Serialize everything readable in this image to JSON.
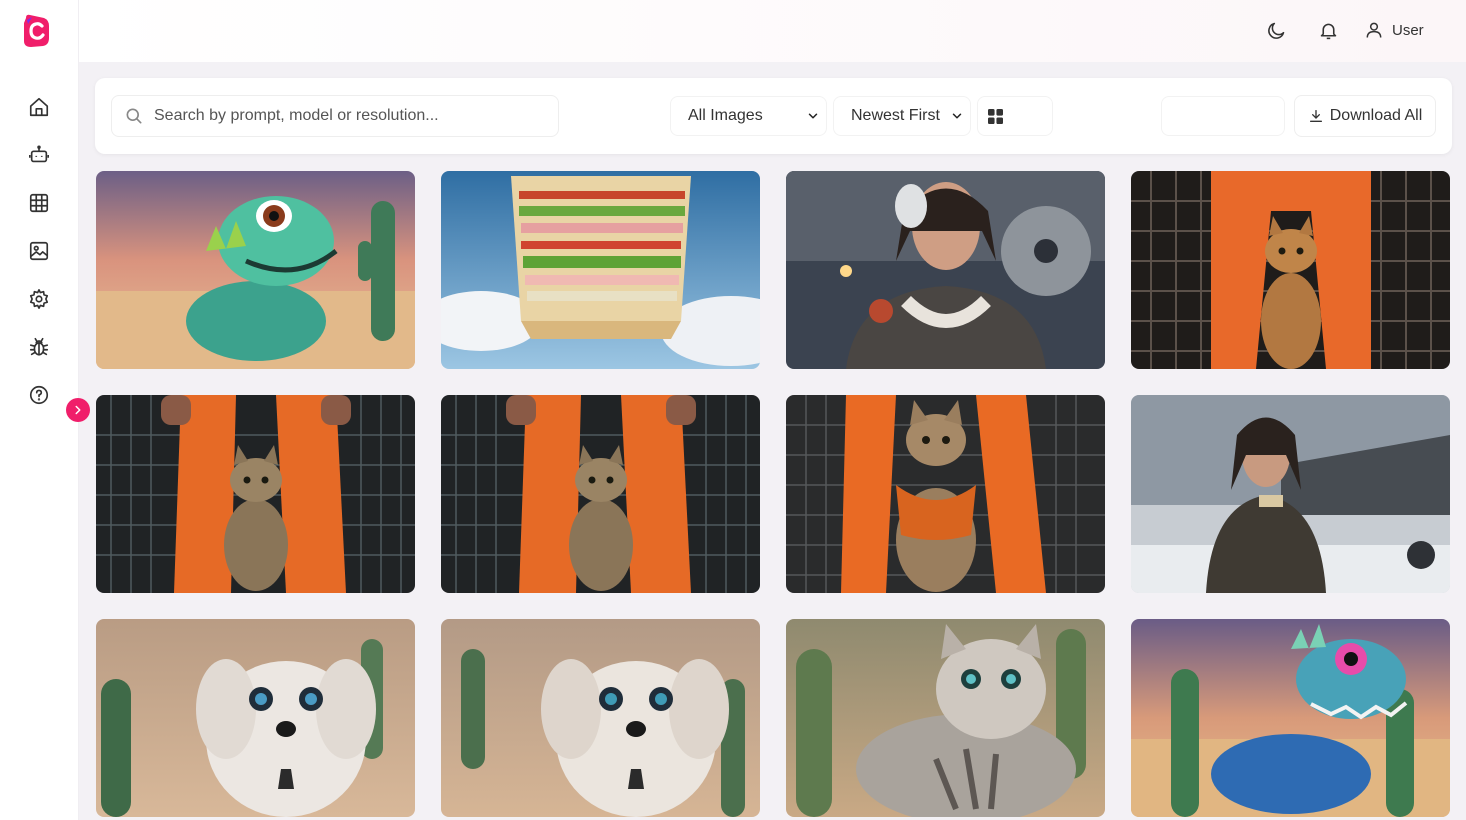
{
  "app": {
    "brand_color": "#f01e6a",
    "logo_icon": "c-logo-icon"
  },
  "sidebar": {
    "items": [
      {
        "name": "home",
        "icon": "home-icon"
      },
      {
        "name": "bot",
        "icon": "robot-icon"
      },
      {
        "name": "grid",
        "icon": "grid-icon"
      },
      {
        "name": "gallery",
        "icon": "image-icon"
      },
      {
        "name": "settings",
        "icon": "gear-icon"
      },
      {
        "name": "debug",
        "icon": "bug-icon"
      },
      {
        "name": "help",
        "icon": "help-circle-icon"
      }
    ],
    "collapse_icon": "chevron-right-icon"
  },
  "header": {
    "theme_icon": "moon-icon",
    "notification_icon": "bell-icon",
    "user_label": "User"
  },
  "toolbar": {
    "search_placeholder": "Search by prompt, model or resolution...",
    "filter_selected": "All Images",
    "sort_selected": "Newest First",
    "view_icon": "grid-view-icon",
    "download_label": "Download All"
  },
  "gallery": {
    "images": [
      {
        "subject": "baby dinosaur in desert"
      },
      {
        "subject": "giant sandwich in sky"
      },
      {
        "subject": "pilot woman with airplane"
      },
      {
        "subject": "cat in front of orange jumpsuit"
      },
      {
        "subject": "cat between orange trousers"
      },
      {
        "subject": "cat between orange trousers"
      },
      {
        "subject": "cat in orange vest"
      },
      {
        "subject": "woman in snow with airplane"
      },
      {
        "subject": "white puppy in desert"
      },
      {
        "subject": "white puppy in desert"
      },
      {
        "subject": "fluffy kitten with cactus"
      },
      {
        "subject": "blue dinosaur in desert"
      }
    ]
  }
}
